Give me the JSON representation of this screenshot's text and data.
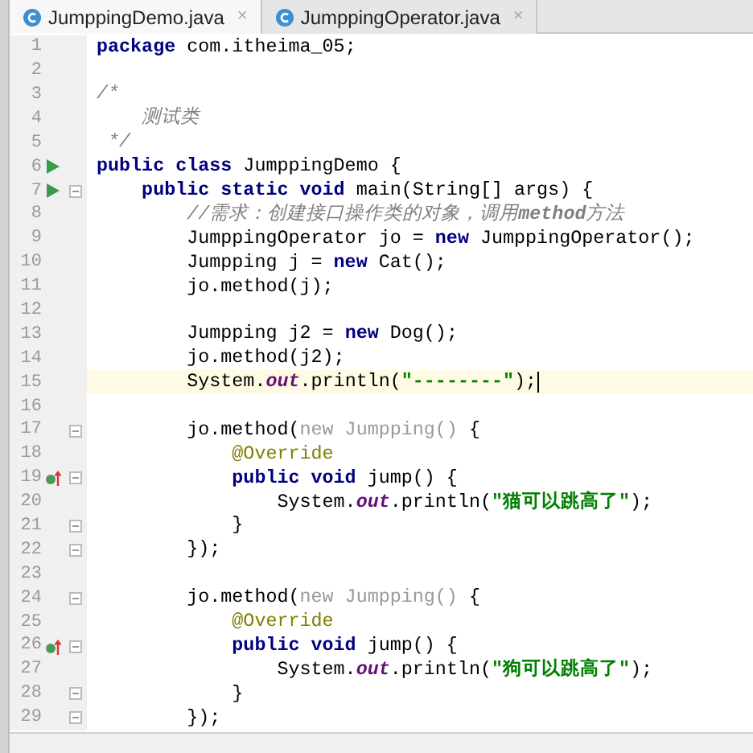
{
  "tabs": [
    {
      "label": "JumppingDemo.java",
      "selected": true,
      "close": "×"
    },
    {
      "label": "JumppingOperator.java",
      "selected": false,
      "close": "×"
    }
  ],
  "lines": [
    {
      "num": "1",
      "tokens": [
        {
          "text": "package",
          "kind": "kw"
        },
        {
          "text": " com.itheima_05;",
          "kind": "plain"
        }
      ]
    },
    {
      "num": "2"
    },
    {
      "num": "3",
      "tokens": [
        {
          "text": "/*",
          "kind": "comment"
        }
      ]
    },
    {
      "num": "4",
      "tokens": [
        {
          "text": "    测试类",
          "kind": "comment"
        }
      ]
    },
    {
      "num": "5",
      "tokens": [
        {
          "text": " */",
          "kind": "comment"
        }
      ]
    },
    {
      "num": "6",
      "kind": "run",
      "tokens": [
        {
          "text": "public class",
          "kind": "kw"
        },
        {
          "text": " JumppingDemo {",
          "kind": "plain"
        }
      ]
    },
    {
      "num": "7",
      "kind": "run",
      "fold": true,
      "tokens": [
        {
          "text": "    public static void",
          "kind": "kw"
        },
        {
          "text": " main(String[] args) {",
          "kind": "plain"
        }
      ]
    },
    {
      "num": "8",
      "tokens": [
        {
          "text": "        //需求：创建接口操作类的对象，调用",
          "kind": "comment"
        },
        {
          "text": "method",
          "kind": "comment-em"
        },
        {
          "text": "方法",
          "kind": "comment"
        }
      ]
    },
    {
      "num": "9",
      "tokens": [
        {
          "text": "        JumppingOperator jo = ",
          "kind": "plain"
        },
        {
          "text": "new",
          "kind": "kw"
        },
        {
          "text": " JumppingOperator();",
          "kind": "plain"
        }
      ]
    },
    {
      "num": "10",
      "tokens": [
        {
          "text": "        Jumpping j = ",
          "kind": "plain"
        },
        {
          "text": "new",
          "kind": "kw"
        },
        {
          "text": " Cat();",
          "kind": "plain"
        }
      ]
    },
    {
      "num": "11",
      "tokens": [
        {
          "text": "        jo.method(j);",
          "kind": "plain"
        }
      ]
    },
    {
      "num": "12"
    },
    {
      "num": "13",
      "tokens": [
        {
          "text": "        Jumpping j2 = ",
          "kind": "plain"
        },
        {
          "text": "new",
          "kind": "kw"
        },
        {
          "text": " Dog();",
          "kind": "plain"
        }
      ]
    },
    {
      "num": "14",
      "tokens": [
        {
          "text": "        jo.method(j2);",
          "kind": "plain"
        }
      ]
    },
    {
      "num": "15",
      "current": true,
      "tokens": [
        {
          "text": "        System.",
          "kind": "plain"
        },
        {
          "text": "out",
          "kind": "field"
        },
        {
          "text": ".println(",
          "kind": "plain"
        },
        {
          "text": "\"--------\"",
          "kind": "str"
        },
        {
          "text": ");",
          "kind": "plain"
        }
      ]
    },
    {
      "num": "16"
    },
    {
      "num": "17",
      "fold": true,
      "tokens": [
        {
          "text": "        jo.method(",
          "kind": "plain"
        },
        {
          "text": "new Jumpping()",
          "kind": "faded"
        },
        {
          "text": " {",
          "kind": "plain"
        }
      ]
    },
    {
      "num": "18",
      "tokens": [
        {
          "text": "            @Override",
          "kind": "annotation"
        }
      ]
    },
    {
      "num": "19",
      "kind": "override",
      "fold": true,
      "tokens": [
        {
          "text": "            public void",
          "kind": "kw"
        },
        {
          "text": " jump() {",
          "kind": "plain"
        }
      ]
    },
    {
      "num": "20",
      "tokens": [
        {
          "text": "                System.",
          "kind": "plain"
        },
        {
          "text": "out",
          "kind": "field"
        },
        {
          "text": ".println(",
          "kind": "plain"
        },
        {
          "text": "\"猫可以跳高了\"",
          "kind": "str"
        },
        {
          "text": ");",
          "kind": "plain"
        }
      ]
    },
    {
      "num": "21",
      "fold": true,
      "tokens": [
        {
          "text": "            }",
          "kind": "plain"
        }
      ]
    },
    {
      "num": "22",
      "fold": true,
      "tokens": [
        {
          "text": "        });",
          "kind": "plain"
        }
      ]
    },
    {
      "num": "23"
    },
    {
      "num": "24",
      "fold": true,
      "tokens": [
        {
          "text": "        jo.method(",
          "kind": "plain"
        },
        {
          "text": "new Jumpping()",
          "kind": "faded"
        },
        {
          "text": " {",
          "kind": "plain"
        }
      ]
    },
    {
      "num": "25",
      "tokens": [
        {
          "text": "            @Override",
          "kind": "annotation"
        }
      ]
    },
    {
      "num": "26",
      "kind": "override",
      "fold": true,
      "tokens": [
        {
          "text": "            public void",
          "kind": "kw"
        },
        {
          "text": " jump() {",
          "kind": "plain"
        }
      ]
    },
    {
      "num": "27",
      "tokens": [
        {
          "text": "                System.",
          "kind": "plain"
        },
        {
          "text": "out",
          "kind": "field"
        },
        {
          "text": ".println(",
          "kind": "plain"
        },
        {
          "text": "\"狗可以跳高了\"",
          "kind": "str"
        },
        {
          "text": ");",
          "kind": "plain"
        }
      ]
    },
    {
      "num": "28",
      "fold": true,
      "tokens": [
        {
          "text": "            }",
          "kind": "plain"
        }
      ]
    },
    {
      "num": "29",
      "fold": true,
      "tokens": [
        {
          "text": "        });",
          "kind": "plain"
        }
      ]
    }
  ]
}
